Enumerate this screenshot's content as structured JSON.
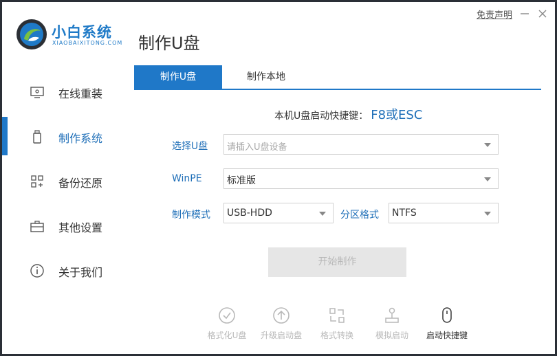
{
  "brand": {
    "name": "小白系统",
    "sub": "XIAOBAIXITONG.COM"
  },
  "header": {
    "page_title": "制作U盘",
    "disclaimer": "免责声明"
  },
  "sidebar": {
    "items": [
      {
        "label": "在线重装",
        "icon": "monitor-icon"
      },
      {
        "label": "制作系统",
        "icon": "usb-drive-icon",
        "active": true
      },
      {
        "label": "备份还原",
        "icon": "grid-icon"
      },
      {
        "label": "其他设置",
        "icon": "briefcase-icon"
      },
      {
        "label": "关于我们",
        "icon": "info-icon"
      }
    ]
  },
  "tabs": [
    {
      "label": "制作U盘",
      "active": true
    },
    {
      "label": "制作本地"
    }
  ],
  "hotkey": {
    "label": "本机U盘启动快捷键：",
    "value": "F8或ESC"
  },
  "form": {
    "usb_label": "选择U盘",
    "usb_placeholder": "请插入U盘设备",
    "winpe_label": "WinPE",
    "winpe_value": "标准版",
    "mode_label": "制作模式",
    "mode_value": "USB-HDD",
    "partition_label": "分区格式",
    "partition_value": "NTFS"
  },
  "start_button": "开始制作",
  "tools": [
    {
      "label": "格式化U盘",
      "icon": "check-circle-icon",
      "enabled": false
    },
    {
      "label": "升级启动盘",
      "icon": "upload-circle-icon",
      "enabled": false
    },
    {
      "label": "格式转换",
      "icon": "convert-icon",
      "enabled": false
    },
    {
      "label": "模拟启动",
      "icon": "joystick-icon",
      "enabled": false
    },
    {
      "label": "启动快捷键",
      "icon": "mouse-icon",
      "enabled": true
    }
  ],
  "colors": {
    "accent": "#1f78c8",
    "disabled": "#b8b8b8"
  }
}
